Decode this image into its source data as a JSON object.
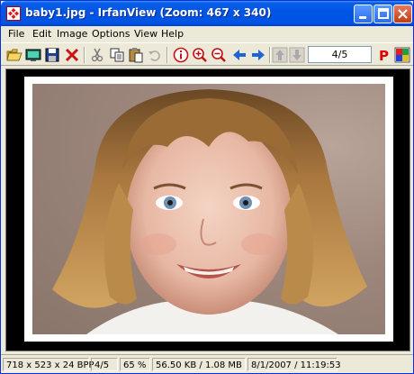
{
  "window": {
    "title": "baby1.jpg - IrfanView (Zoom: 467 x 340)"
  },
  "menu": {
    "items": [
      "File",
      "Edit",
      "Image",
      "Options",
      "View",
      "Help"
    ]
  },
  "toolbar": {
    "page_indicator": "4/5",
    "colors": {
      "open": "#d9a520",
      "save": "#1f3f8f",
      "delete": "#cc1111",
      "info": "#cc1111",
      "nav_arrow": "#1e64d6",
      "print_p": "#e00000"
    }
  },
  "image": {
    "description_label": "photo"
  },
  "status": {
    "dimensions": "718 x 523 x 24 BPP",
    "index": "4/5",
    "zoom": "65 %",
    "size": "56.50 KB / 1.08 MB",
    "datetime": "8/1/2007 / 11:19:53"
  }
}
